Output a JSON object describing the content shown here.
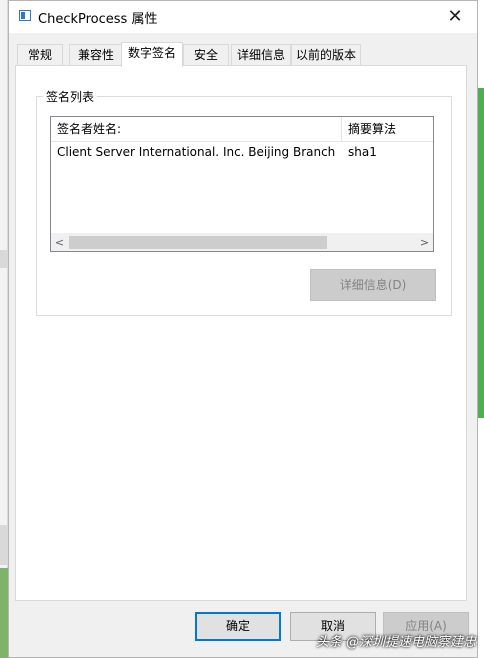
{
  "window": {
    "title": "CheckProcess 属性",
    "close_glyph": "✕"
  },
  "tabs": [
    {
      "label": "常规"
    },
    {
      "label": "兼容性"
    },
    {
      "label": "数字签名"
    },
    {
      "label": "安全"
    },
    {
      "label": "详细信息"
    },
    {
      "label": "以前的版本"
    }
  ],
  "active_tab": "数字签名",
  "signature_list": {
    "group_label": "签名列表",
    "columns": [
      "签名者姓名:",
      "摘要算法"
    ],
    "rows": [
      {
        "signer": "Client Server International. Inc. Beijing Branch",
        "digest": "sha1"
      }
    ],
    "scroll_left_glyph": "<",
    "scroll_right_glyph": ">"
  },
  "details_button": "详细信息(D)",
  "footer": {
    "ok": "确定",
    "cancel": "取消",
    "apply": "应用(A)"
  },
  "watermark": "头条 @深圳提速电脑察建忠",
  "colors": {
    "focus_border": "#0078d7",
    "disabled_text": "#838383",
    "accent_icon": "#2b78d0"
  }
}
